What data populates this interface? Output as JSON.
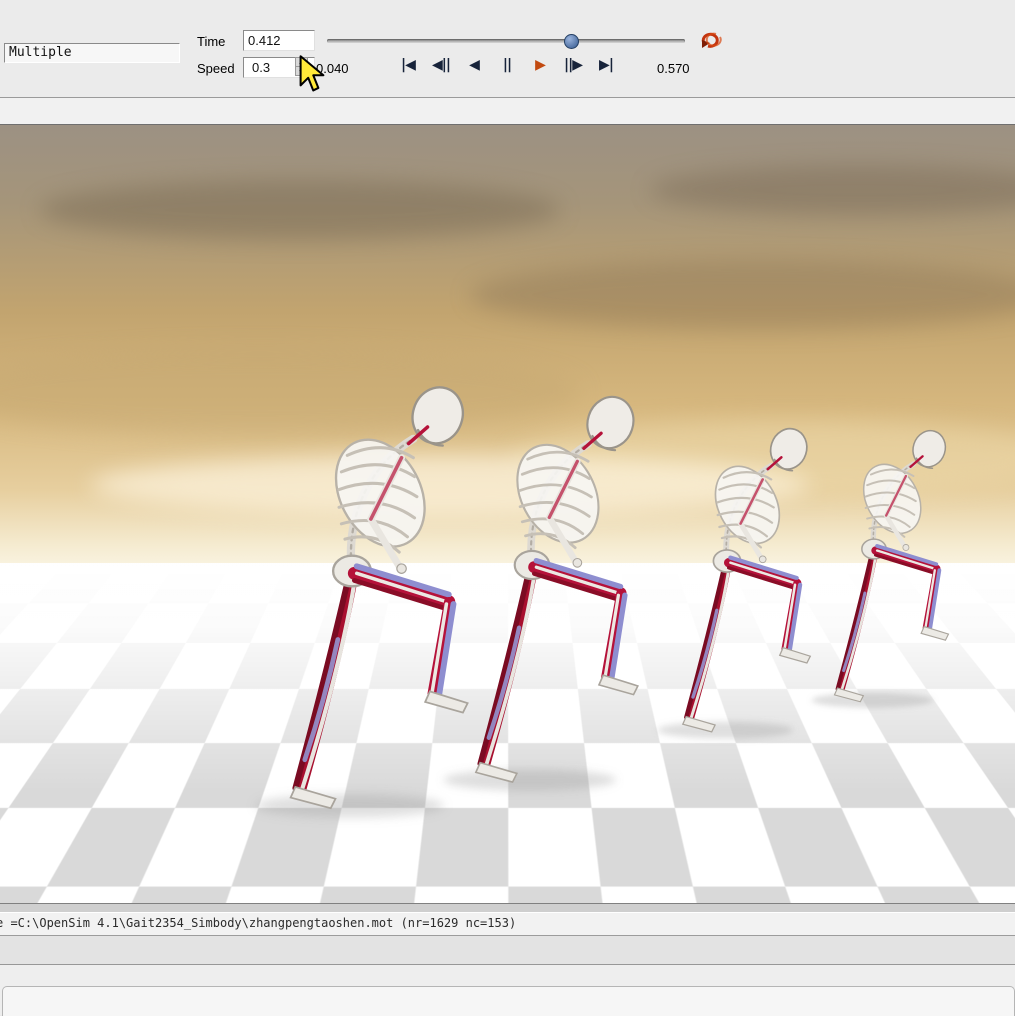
{
  "toolbar": {
    "model_selector": {
      "value": "Multiple"
    },
    "time": {
      "label": "Time",
      "value": "0.412"
    },
    "speed": {
      "label": "Speed",
      "value": "0.3"
    },
    "frame_increment": "0.040",
    "end_time": "0.570",
    "playback": {
      "to_start": "|◀",
      "step_back": "◀||",
      "play_reverse": "◀",
      "pause": "||",
      "play": "▶",
      "step_forward": "||▶",
      "to_end": "▶|"
    },
    "slider": {
      "current_value": "0.412",
      "max_value": "0.570"
    }
  },
  "statusbar": {
    "text": "e =C:\\OpenSim 4.1\\Gait2354_Simbody\\zhangpengtaoshen.mot (nr=1629 nc=153)"
  },
  "colors": {
    "play_button": "#c24a10",
    "loop_icon": "#c2340f",
    "slider_handle": "#35598f",
    "muscle_red": "#b5123a",
    "muscle_blue": "#8e8ed0",
    "sky_gold": "#d6b77e",
    "floor_check": "#d9d9d9"
  }
}
